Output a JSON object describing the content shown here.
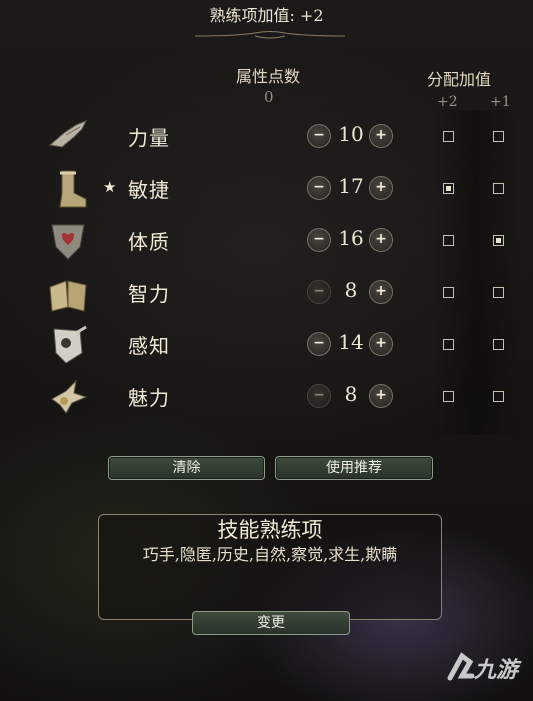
{
  "header": {
    "proficiency_bonus": "熟练项加值: +2"
  },
  "columns": {
    "attribute_points_label": "属性点数",
    "attribute_points_remaining": "0",
    "bonus_label": "分配加值",
    "bonus_plus2": "+2",
    "bonus_plus1": "+1"
  },
  "abilities": [
    {
      "name": "力量",
      "value": "10",
      "icon": "gauntlet-icon",
      "primary": false,
      "minus_enabled": true,
      "bonus2": false,
      "bonus1": false
    },
    {
      "name": "敏捷",
      "value": "17",
      "icon": "boot-icon",
      "primary": true,
      "minus_enabled": true,
      "bonus2": true,
      "bonus1": false
    },
    {
      "name": "体质",
      "value": "16",
      "icon": "heart-shield-icon",
      "primary": false,
      "minus_enabled": true,
      "bonus2": false,
      "bonus1": true
    },
    {
      "name": "智力",
      "value": "8",
      "icon": "book-icon",
      "primary": false,
      "minus_enabled": false,
      "bonus2": false,
      "bonus1": false
    },
    {
      "name": "感知",
      "value": "14",
      "icon": "eye-hand-icon",
      "primary": false,
      "minus_enabled": true,
      "bonus2": false,
      "bonus1": false
    },
    {
      "name": "魅力",
      "value": "8",
      "icon": "bird-icon",
      "primary": false,
      "minus_enabled": false,
      "bonus2": false,
      "bonus1": false
    }
  ],
  "primary_marker": "★",
  "minus_glyph": "−",
  "plus_glyph": "+",
  "buttons": {
    "clear": "清除",
    "use_recommended": "使用推荐",
    "change": "变更"
  },
  "skills": {
    "title": "技能熟练项",
    "list": "巧手,隐匿,历史,自然,察觉,求生,欺瞒"
  },
  "watermark": {
    "text": "九游"
  }
}
